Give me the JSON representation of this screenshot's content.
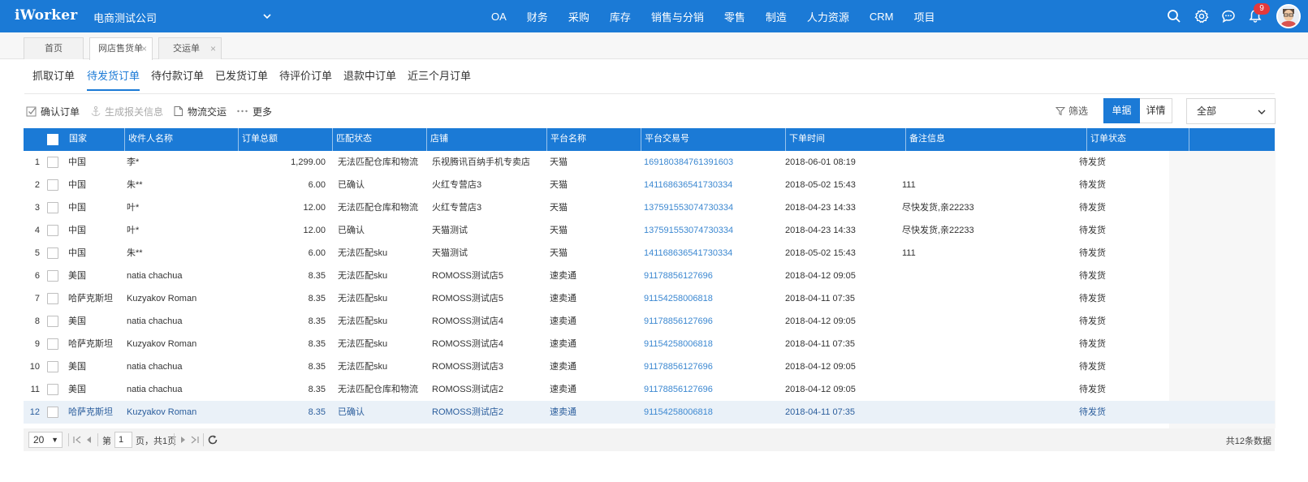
{
  "app": {
    "logo": "iWorker",
    "company": "电商测试公司"
  },
  "nav": [
    "OA",
    "财务",
    "采购",
    "库存",
    "销售与分销",
    "零售",
    "制造",
    "人力资源",
    "CRM",
    "项目"
  ],
  "notifications": {
    "count": "9"
  },
  "icons": {
    "search": "search-icon",
    "settings": "gear-icon",
    "chat": "chat-icon",
    "bell": "bell-icon"
  },
  "page_tabs": [
    {
      "label": "首页"
    },
    {
      "label": "网店售货单",
      "close": "×"
    },
    {
      "label": "交运单",
      "close": "×"
    }
  ],
  "sub_tabs": [
    "抓取订单",
    "待发货订单",
    "待付款订单",
    "已发货订单",
    "待评价订单",
    "退款中订单",
    "近三个月订单"
  ],
  "toolbar": {
    "confirm": "确认订单",
    "generate": "生成报关信息",
    "logistics": "物流交运",
    "more": "更多",
    "filter": "筛选",
    "view_doc": "单据",
    "view_detail": "详情",
    "status_select": "全部"
  },
  "colors": {
    "primary": "#1b7ad6",
    "link": "#3c88d1",
    "selected_row": "#eaf1f8",
    "badge": "#e4393c"
  },
  "table": {
    "headers": [
      "国家",
      "收件人名称",
      "订单总额",
      "匹配状态",
      "店铺",
      "平台名称",
      "平台交易号",
      "下单时间",
      "备注信息",
      "订单状态"
    ],
    "rows": [
      {
        "n": "1",
        "country": "中国",
        "name": "李*",
        "amount": "1,299.00",
        "match": "无法匹配仓库和物流",
        "shop": "乐视腾讯百纳手机专卖店",
        "platform": "天猫",
        "trade_no": "169180384761391603",
        "time": "2018-06-01 08:19",
        "note": "",
        "status": "待发货"
      },
      {
        "n": "2",
        "country": "中国",
        "name": "朱**",
        "amount": "6.00",
        "match": "已确认",
        "shop": "火红专营店3",
        "platform": "天猫",
        "trade_no": "141168636541730334",
        "time": "2018-05-02 15:43",
        "note": "111",
        "status": "待发货"
      },
      {
        "n": "3",
        "country": "中国",
        "name": "叶*",
        "amount": "12.00",
        "match": "无法匹配仓库和物流",
        "shop": "火红专营店3",
        "platform": "天猫",
        "trade_no": "137591553074730334",
        "time": "2018-04-23 14:33",
        "note": "尽快发货,亲22233",
        "status": "待发货"
      },
      {
        "n": "4",
        "country": "中国",
        "name": "叶*",
        "amount": "12.00",
        "match": "已确认",
        "shop": "天猫测试",
        "platform": "天猫",
        "trade_no": "137591553074730334",
        "time": "2018-04-23 14:33",
        "note": "尽快发货,亲22233",
        "status": "待发货"
      },
      {
        "n": "5",
        "country": "中国",
        "name": "朱**",
        "amount": "6.00",
        "match": "无法匹配sku",
        "shop": "天猫测试",
        "platform": "天猫",
        "trade_no": "141168636541730334",
        "time": "2018-05-02 15:43",
        "note": "111",
        "status": "待发货"
      },
      {
        "n": "6",
        "country": "美国",
        "name": "natia chachua",
        "amount": "8.35",
        "match": "无法匹配sku",
        "shop": "ROMOSS测试店5",
        "platform": "速卖通",
        "trade_no": "91178856127696",
        "time": "2018-04-12 09:05",
        "note": "",
        "status": "待发货"
      },
      {
        "n": "7",
        "country": "哈萨克斯坦",
        "name": "Kuzyakov Roman",
        "amount": "8.35",
        "match": "无法匹配sku",
        "shop": "ROMOSS测试店5",
        "platform": "速卖通",
        "trade_no": "91154258006818",
        "time": "2018-04-11 07:35",
        "note": "",
        "status": "待发货"
      },
      {
        "n": "8",
        "country": "美国",
        "name": "natia chachua",
        "amount": "8.35",
        "match": "无法匹配sku",
        "shop": "ROMOSS测试店4",
        "platform": "速卖通",
        "trade_no": "91178856127696",
        "time": "2018-04-12 09:05",
        "note": "",
        "status": "待发货"
      },
      {
        "n": "9",
        "country": "哈萨克斯坦",
        "name": "Kuzyakov Roman",
        "amount": "8.35",
        "match": "无法匹配sku",
        "shop": "ROMOSS测试店4",
        "platform": "速卖通",
        "trade_no": "91154258006818",
        "time": "2018-04-11 07:35",
        "note": "",
        "status": "待发货"
      },
      {
        "n": "10",
        "country": "美国",
        "name": "natia chachua",
        "amount": "8.35",
        "match": "无法匹配sku",
        "shop": "ROMOSS测试店3",
        "platform": "速卖通",
        "trade_no": "91178856127696",
        "time": "2018-04-12 09:05",
        "note": "",
        "status": "待发货"
      },
      {
        "n": "11",
        "country": "美国",
        "name": "natia chachua",
        "amount": "8.35",
        "match": "无法匹配仓库和物流",
        "shop": "ROMOSS测试店2",
        "platform": "速卖通",
        "trade_no": "91178856127696",
        "time": "2018-04-12 09:05",
        "note": "",
        "status": "待发货"
      },
      {
        "n": "12",
        "country": "哈萨克斯坦",
        "name": "Kuzyakov Roman",
        "amount": "8.35",
        "match": "已确认",
        "shop": "ROMOSS测试店2",
        "platform": "速卖通",
        "trade_no": "91154258006818",
        "time": "2018-04-11 07:35",
        "note": "",
        "status": "待发货"
      }
    ]
  },
  "pagination": {
    "page_size": "20",
    "page_prefix": "第",
    "page": "1",
    "page_suffix": "页，共1页",
    "total": "共12条数据"
  }
}
